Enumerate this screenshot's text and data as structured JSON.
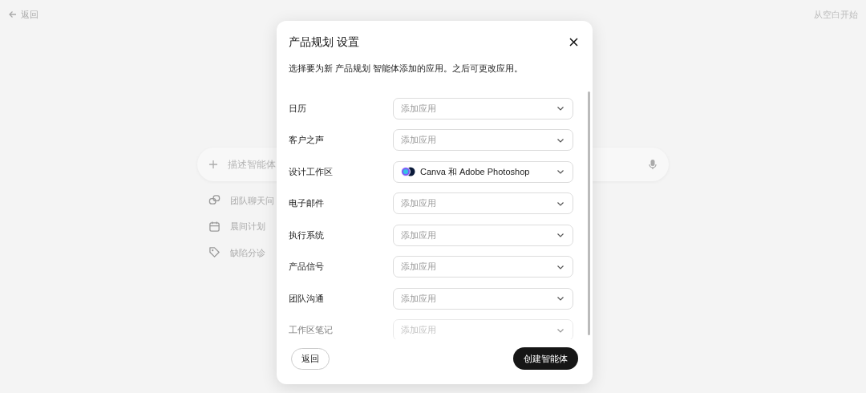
{
  "top_bar": {
    "back": "返回",
    "start_blank": "从空白开始"
  },
  "prompt": {
    "placeholder": "描述智能体"
  },
  "suggestions": [
    {
      "kind": "chat",
      "label": "团队聊天问"
    },
    {
      "kind": "calendar",
      "label": "晨间计划"
    },
    {
      "kind": "tag",
      "label": "缺陷分诊"
    }
  ],
  "dialog": {
    "title": "产品规划 设置",
    "description": "选择要为新 产品规划 智能体添加的应用。之后可更改应用。",
    "rows": [
      {
        "label": "日历",
        "placeholder": "添加应用",
        "faded": false
      },
      {
        "label": "客户之声",
        "placeholder": "添加应用",
        "faded": false
      },
      {
        "label": "设计工作区",
        "value": "Canva 和 Adobe Photoshop",
        "faded": false
      },
      {
        "label": "电子邮件",
        "placeholder": "添加应用",
        "faded": false
      },
      {
        "label": "执行系统",
        "placeholder": "添加应用",
        "faded": false
      },
      {
        "label": "产品信号",
        "placeholder": "添加应用",
        "faded": false
      },
      {
        "label": "团队沟通",
        "placeholder": "添加应用",
        "faded": false
      },
      {
        "label": "工作区笔记",
        "placeholder": "添加应用",
        "faded": true
      }
    ],
    "back_button": "返回",
    "create_button": "创建智能体"
  }
}
